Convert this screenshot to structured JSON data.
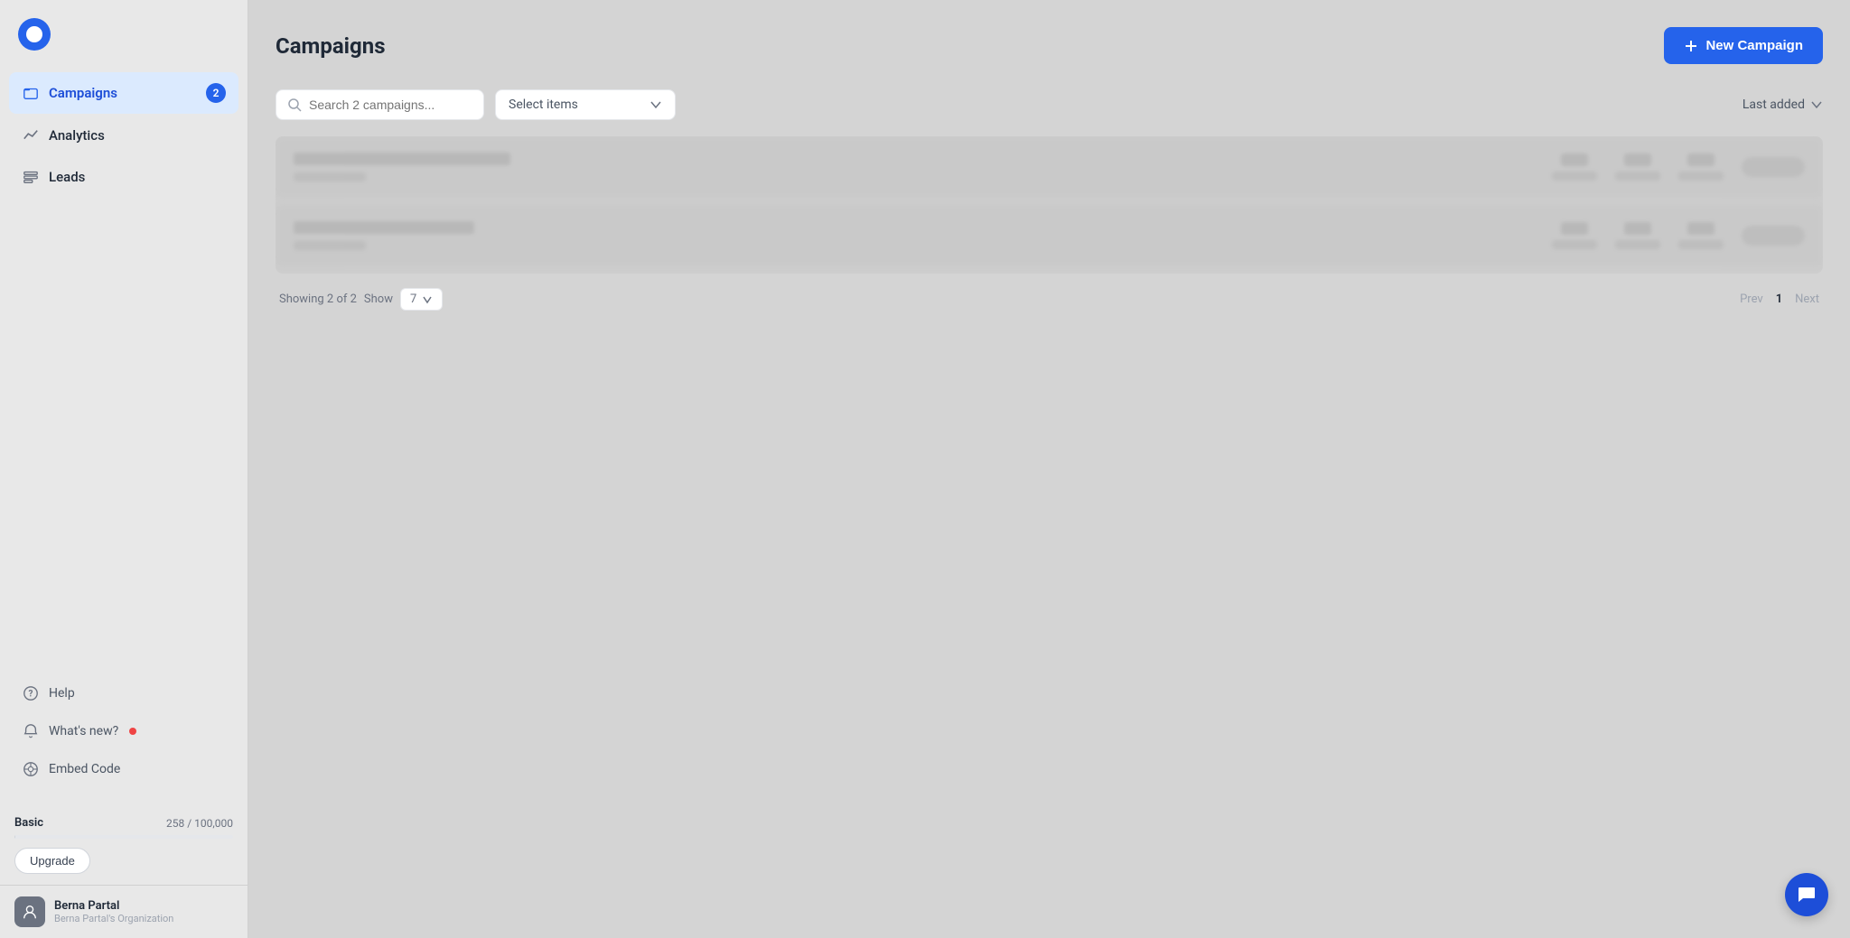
{
  "app": {
    "logo_alt": "App Logo"
  },
  "sidebar": {
    "nav_items": [
      {
        "id": "campaigns",
        "label": "Campaigns",
        "icon": "folder",
        "active": true,
        "badge": "2"
      },
      {
        "id": "analytics",
        "label": "Analytics",
        "icon": "analytics",
        "active": false,
        "badge": null
      },
      {
        "id": "leads",
        "label": "Leads",
        "icon": "leads",
        "active": false,
        "badge": null
      }
    ],
    "bottom_items": [
      {
        "id": "help",
        "label": "Help",
        "icon": "help",
        "notification": false
      },
      {
        "id": "whats-new",
        "label": "What's new?",
        "icon": "bell",
        "notification": true
      },
      {
        "id": "embed-code",
        "label": "Embed Code",
        "icon": "embed",
        "notification": false
      }
    ],
    "plan": {
      "name": "Basic",
      "usage": "258 / 100,000",
      "progress_pct": 0.3
    },
    "upgrade_label": "Upgrade",
    "user": {
      "name": "Berna Partal",
      "org": "Berna Partal's Organization"
    }
  },
  "page": {
    "title": "Campaigns",
    "new_campaign_label": "New Campaign"
  },
  "toolbar": {
    "search_placeholder": "Search 2 campaigns...",
    "select_items_label": "Select items",
    "sort_label": "Last added"
  },
  "campaigns": {
    "showing_text": "Showing 2 of 2",
    "show_label": "Show",
    "show_value": "7",
    "items": [
      {
        "id": 1,
        "blurred": true
      },
      {
        "id": 2,
        "blurred": true
      }
    ]
  },
  "pagination": {
    "prev_label": "Prev",
    "next_label": "Next",
    "current_page": "1"
  }
}
